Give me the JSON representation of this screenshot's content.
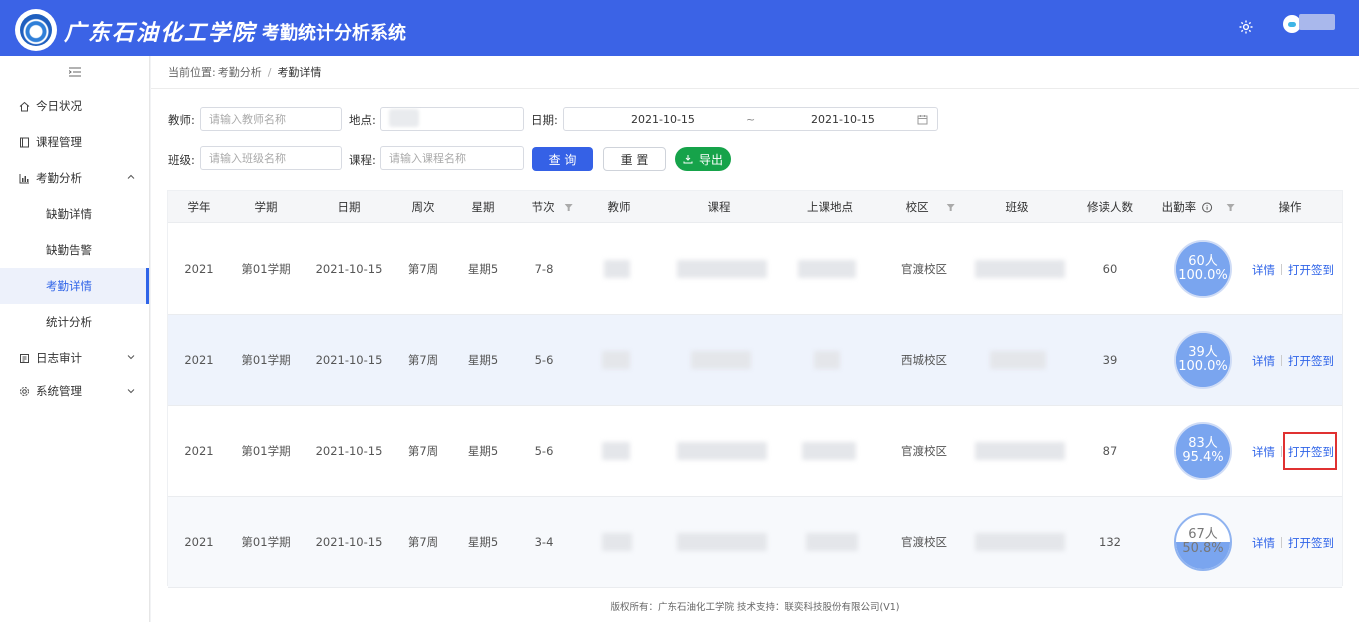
{
  "header": {
    "school_name": "广东石油化工学院",
    "system_title": "考勤统计分析系统"
  },
  "sidebar": {
    "items": [
      {
        "label": "今日状况",
        "icon": "home-icon"
      },
      {
        "label": "课程管理",
        "icon": "book-icon"
      },
      {
        "label": "考勤分析",
        "icon": "chart-icon",
        "expanded": true,
        "children": [
          {
            "label": "缺勤详情"
          },
          {
            "label": "缺勤告警"
          },
          {
            "label": "考勤详情",
            "active": true
          },
          {
            "label": "统计分析"
          }
        ]
      },
      {
        "label": "日志审计",
        "icon": "log-icon"
      },
      {
        "label": "系统管理",
        "icon": "gear-icon"
      }
    ]
  },
  "breadcrumb": {
    "prefix": "当前位置:",
    "parent": "考勤分析",
    "separator": "/",
    "current": "考勤详情"
  },
  "filters": {
    "teacher_label": "教师:",
    "teacher_placeholder": "请输入教师名称",
    "location_label": "地点:",
    "date_label": "日期:",
    "date_start": "2021-10-15",
    "date_sep": "~",
    "date_end": "2021-10-15",
    "class_label": "班级:",
    "class_placeholder": "请输入班级名称",
    "course_label": "课程:",
    "course_placeholder": "请输入课程名称",
    "query_button": "查 询",
    "reset_button": "重 置",
    "export_button": "导出"
  },
  "table": {
    "columns": [
      "学年",
      "学期",
      "日期",
      "周次",
      "星期",
      "节次",
      "教师",
      "课程",
      "上课地点",
      "校区",
      "班级",
      "修读人数",
      "出勤率",
      "操作"
    ],
    "rows": [
      {
        "year": "2021",
        "term": "第01学期",
        "date": "2021-10-15",
        "week": "第7周",
        "weekday": "星期5",
        "section": "7-8",
        "campus": "官渡校区",
        "students": "60",
        "gauge_count": "60人",
        "gauge_rate": "100.0%",
        "rate": 1.0
      },
      {
        "year": "2021",
        "term": "第01学期",
        "date": "2021-10-15",
        "week": "第7周",
        "weekday": "星期5",
        "section": "5-6",
        "campus": "西城校区",
        "students": "39",
        "gauge_count": "39人",
        "gauge_rate": "100.0%",
        "rate": 1.0
      },
      {
        "year": "2021",
        "term": "第01学期",
        "date": "2021-10-15",
        "week": "第7周",
        "weekday": "星期5",
        "section": "5-6",
        "campus": "官渡校区",
        "students": "87",
        "gauge_count": "83人",
        "gauge_rate": "95.4%",
        "rate": 0.954
      },
      {
        "year": "2021",
        "term": "第01学期",
        "date": "2021-10-15",
        "week": "第7周",
        "weekday": "星期5",
        "section": "3-4",
        "campus": "官渡校区",
        "students": "132",
        "gauge_count": "67人",
        "gauge_rate": "50.8%",
        "rate": 0.508
      }
    ],
    "actions": {
      "detail": "详情",
      "open_signin": "打开签到"
    }
  },
  "footer": {
    "text": "版权所有：广东石油化工学院 技术支持：联奕科技股份有限公司(V1)"
  }
}
